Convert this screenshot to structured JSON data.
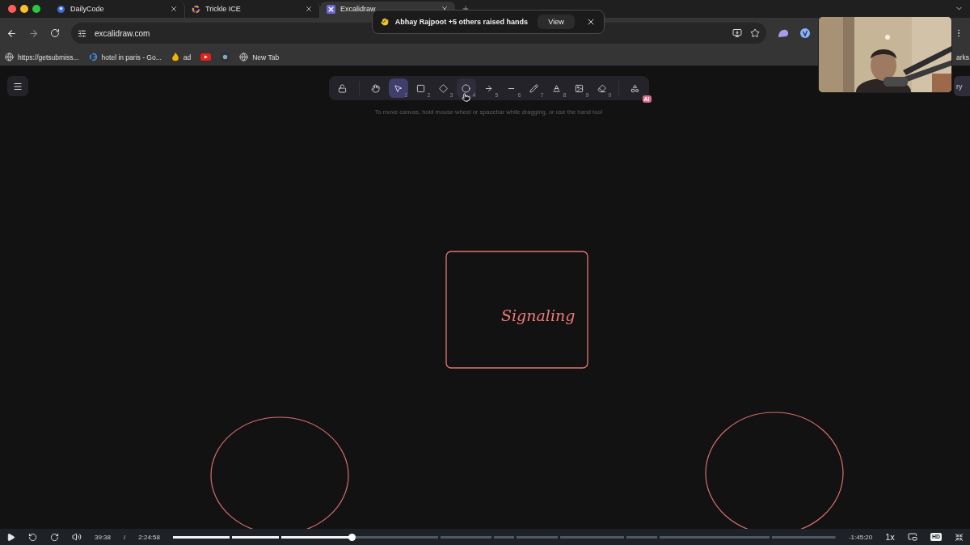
{
  "browser": {
    "tabs": [
      {
        "title": "DailyCode",
        "selected": false
      },
      {
        "title": "Trickle ICE",
        "selected": false
      },
      {
        "title": "Excalidraw",
        "selected": true
      }
    ],
    "notification": {
      "message": "Abhay Rajpoot +5 others raised hands",
      "action": "View"
    },
    "address": "excalidraw.com",
    "bookmarks": [
      {
        "kind": "labeled",
        "title": "https://getsubmiss..."
      },
      {
        "kind": "labeled",
        "title": "hotel in paris - Go..."
      },
      {
        "kind": "labeled",
        "title": "ad"
      },
      {
        "kind": "icon"
      },
      {
        "kind": "icon"
      },
      {
        "kind": "labeled",
        "title": "New Tab"
      }
    ],
    "bookmarks_overflow": "arks"
  },
  "excalidraw": {
    "tools": [
      {
        "selected": false,
        "hovered": false
      },
      {
        "selected": false,
        "hovered": false
      },
      {
        "shortcut": "1",
        "selected": true,
        "hovered": false
      },
      {
        "shortcut": "2",
        "selected": false,
        "hovered": false
      },
      {
        "shortcut": "3",
        "selected": false,
        "hovered": false
      },
      {
        "shortcut": "4",
        "selected": false,
        "hovered": true
      },
      {
        "shortcut": "5",
        "selected": false,
        "hovered": false
      },
      {
        "shortcut": "6",
        "selected": false,
        "hovered": false
      },
      {
        "shortcut": "7",
        "selected": false,
        "hovered": false
      },
      {
        "shortcut": "8",
        "selected": false,
        "hovered": false
      },
      {
        "shortcut": "9",
        "selected": false,
        "hovered": false
      },
      {
        "shortcut": "0",
        "selected": false,
        "hovered": false
      },
      {
        "badge": "AI",
        "selected": false,
        "hovered": false
      }
    ],
    "hint": "To move canvas, hold mouse wheel or spacebar while dragging, or use the hand tool",
    "library_button": "ry",
    "shapes": [
      {
        "kind": "rectangle",
        "label": "Signaling"
      },
      {
        "kind": "ellipse"
      },
      {
        "kind": "ellipse"
      }
    ]
  },
  "player": {
    "elapsed": "39:38",
    "separator": "/",
    "duration": "2:24:58",
    "level": 0.27,
    "remaining": "-1:45:20",
    "speed": "1x",
    "quality": "HD"
  }
}
